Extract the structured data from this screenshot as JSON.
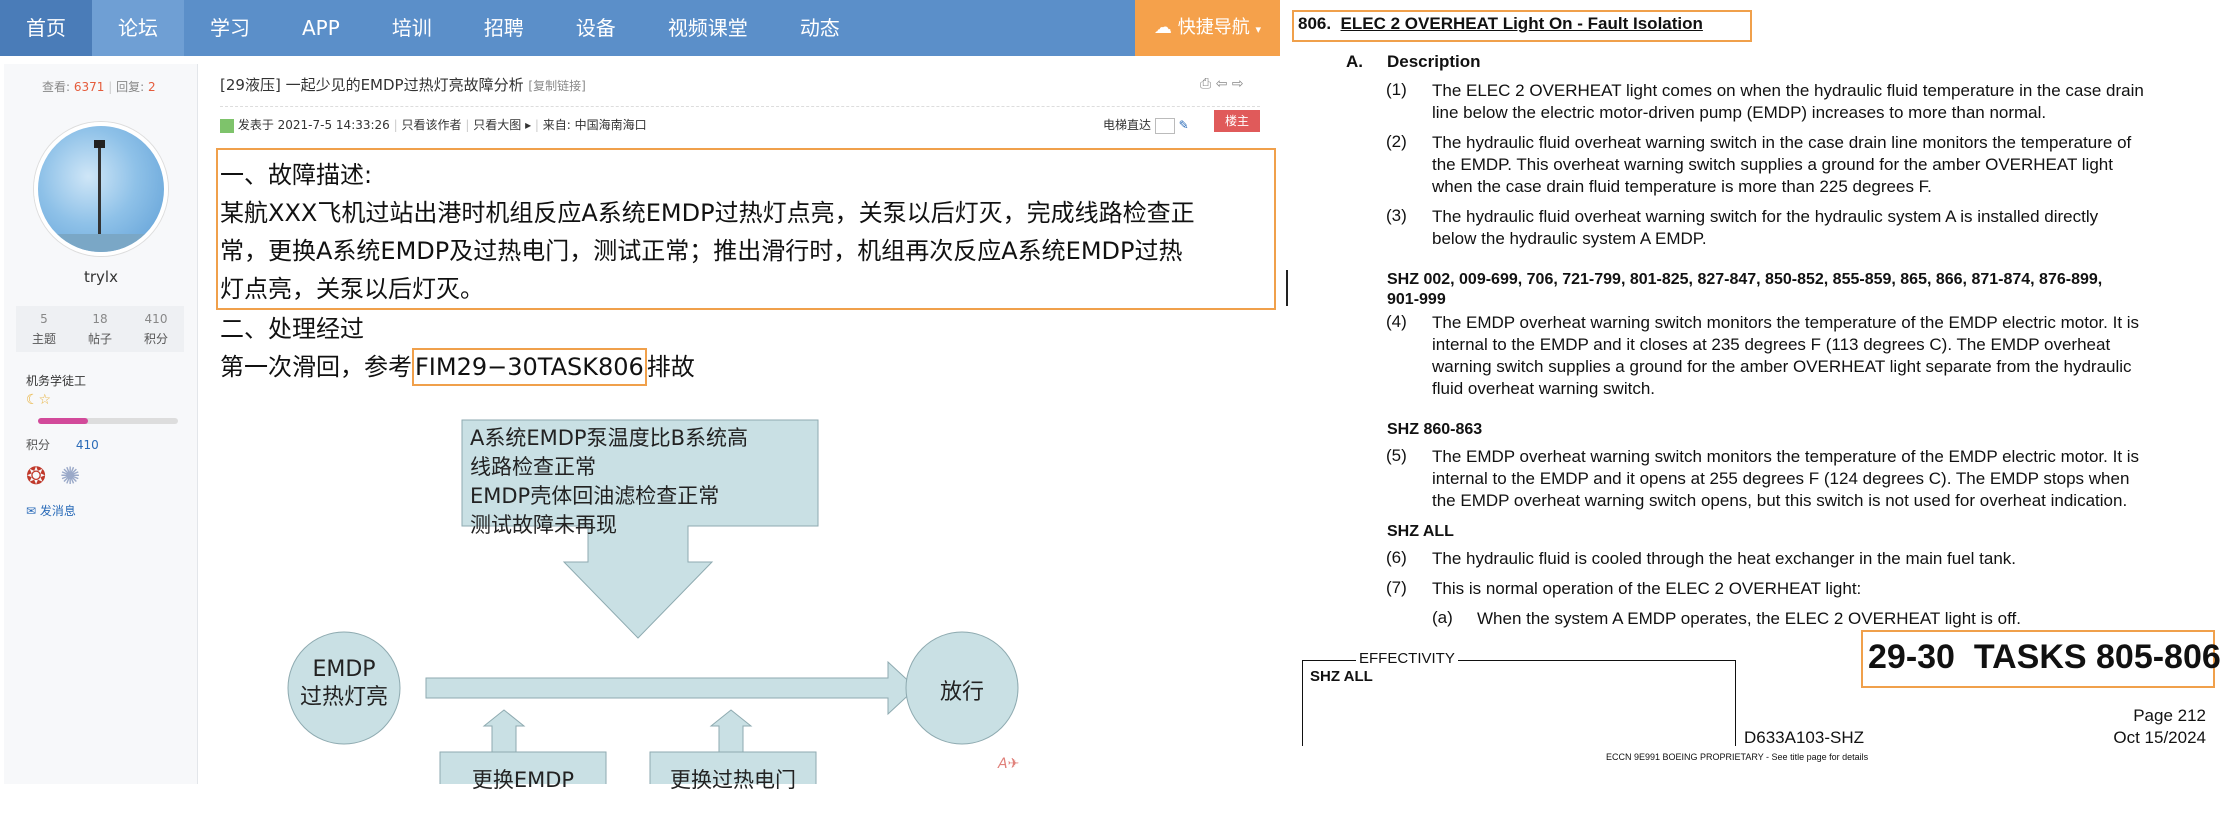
{
  "nav": {
    "items": [
      "首页",
      "论坛",
      "学习",
      "APP",
      "培训",
      "招聘",
      "设备",
      "视频课堂",
      "动态"
    ],
    "quick_nav": "快捷导航"
  },
  "sidebar": {
    "views_label": "查看:",
    "views": "6371",
    "replies_label": "回复:",
    "replies": "2",
    "username": "trylx",
    "stats": [
      {
        "value": "5",
        "label": "主题"
      },
      {
        "value": "18",
        "label": "帖子"
      },
      {
        "value": "410",
        "label": "积分"
      }
    ],
    "rank": "机务学徒工",
    "points_label": "积分",
    "points": "410",
    "message": "发消息"
  },
  "post": {
    "tag": "[29液压]",
    "title": "一起少见的EMDP过热灯亮故障分析",
    "copy_link": "[复制链接]",
    "posted_at": "发表于 2021-7-5 14:33:26",
    "only_author": "只看该作者",
    "big_image": "只看大图",
    "from_label": "来自:",
    "from": "中国海南海口",
    "elevator": "电梯直达",
    "floor_badge": "楼主",
    "fault_heading": "一、故障描述:",
    "fault_text_1": "某航XXX飞机过站出港时机组反应A系统EMDP过热灯点亮，关泵以后灯灭，完成线路检查正",
    "fault_text_2": "常，更换A系统EMDP及过热电门，测试正常；推出滑行时，机组再次反应A系统EMDP过热",
    "fault_text_3": "灯点亮，关泵以后灯灭。",
    "process_heading": "二、处理经过",
    "process_prefix": "第一次滑回，参考",
    "process_ref": "FIM29−30TASK806",
    "process_suffix": "排故",
    "diagram": {
      "callout_lines": [
        "A系统EMDP泵温度比B系统高",
        "线路检查正常",
        "EMDP壳体回油滤检查正常",
        "测试故障未再现"
      ],
      "start_circle": [
        "EMDP",
        "过热灯亮"
      ],
      "end_circle": "放行",
      "box_1": "更换EMDP",
      "box_2": "更换过热电门"
    }
  },
  "doc": {
    "heading_num": "806.",
    "heading": "ELEC 2 OVERHEAT Light On - Fault Isolation",
    "section_letter": "A.",
    "section_title": "Description",
    "items": [
      {
        "num": "(1)",
        "lines": [
          "The ELEC 2 OVERHEAT light comes on when the hydraulic fluid temperature in the case drain",
          "line below the electric motor-driven pump (EMDP) increases to more than normal."
        ]
      },
      {
        "num": "(2)",
        "lines": [
          "The hydraulic fluid overheat warning switch in the case drain line monitors the temperature of",
          "the EMDP. This overheat warning switch supplies a ground for the amber OVERHEAT light",
          "when the case drain fluid temperature is more than 225 degrees F."
        ]
      },
      {
        "num": "(3)",
        "lines": [
          "The hydraulic fluid overheat warning switch for the hydraulic system A is installed directly",
          "below the hydraulic system A EMDP."
        ]
      }
    ],
    "eff_1": [
      "SHZ 002, 009-699, 706, 721-799, 801-825, 827-847, 850-852, 855-859, 865, 866, 871-874, 876-899,",
      "901-999"
    ],
    "item_4": {
      "num": "(4)",
      "lines": [
        "The EMDP overheat warning switch monitors the temperature of the EMDP electric motor. It is",
        "internal to the EMDP and it closes at 235 degrees F (113 degrees C). The EMDP overheat",
        "warning switch supplies a ground for the amber OVERHEAT light separate from the hydraulic",
        "fluid overheat warning switch."
      ]
    },
    "eff_2": "SHZ 860-863",
    "item_5": {
      "num": "(5)",
      "lines": [
        "The EMDP overheat warning switch monitors the temperature of the EMDP electric motor. It is",
        "internal to the EMDP and it opens at 255 degrees F (124 degrees C). The EMDP stops when",
        "the EMDP overheat warning switch opens, but this switch is not used for overheat indication."
      ]
    },
    "eff_3": "SHZ ALL",
    "item_6": {
      "num": "(6)",
      "text": "The hydraulic fluid is cooled through the heat exchanger in the main fuel tank."
    },
    "item_7": {
      "num": "(7)",
      "text": "This is normal operation of the ELEC 2 OVERHEAT light:"
    },
    "item_7a": {
      "num": "(a)",
      "text": "When the system A EMDP operates, the ELEC 2 OVERHEAT light is off."
    },
    "effectivity_label": "EFFECTIVITY",
    "effectivity_value": "SHZ ALL",
    "task_ref": "29-30  TASKS 805-806",
    "page": "Page 212",
    "date": "Oct 15/2024",
    "doc_id": "D633A103-SHZ",
    "footer": "ECCN 9E991 BOEING PROPRIETARY - See title page for details"
  },
  "colors": {
    "nav": "#5b8fc9",
    "highlight": "#f0a04b",
    "diagram": "#c9e0e4"
  }
}
